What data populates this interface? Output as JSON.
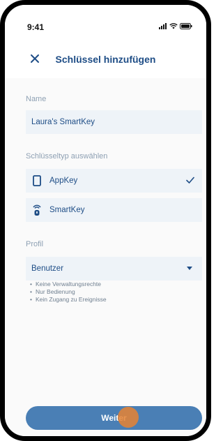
{
  "status": {
    "time": "9:41"
  },
  "nav": {
    "title": "Schlüssel hinzufügen"
  },
  "form": {
    "name_label": "Name",
    "name_value": "Laura's SmartKey",
    "type_label": "Schlüsseltyp auswählen",
    "types": [
      {
        "label": "AppKey",
        "selected": true,
        "icon": "phone-icon"
      },
      {
        "label": "SmartKey",
        "selected": false,
        "icon": "smartkey-icon"
      }
    ],
    "profile_label": "Profil",
    "profile_value": "Benutzer",
    "profile_notes": [
      "Keine Verwaltungsrechte",
      "Nur Bedienung",
      "Kein Zugang zu Ereignisse"
    ]
  },
  "footer": {
    "next_label": "Weiter"
  },
  "colors": {
    "primary": "#1e4d86",
    "button": "#4a7fb5",
    "field_bg": "#eef3f8",
    "touch_indicator": "#e6822f"
  }
}
